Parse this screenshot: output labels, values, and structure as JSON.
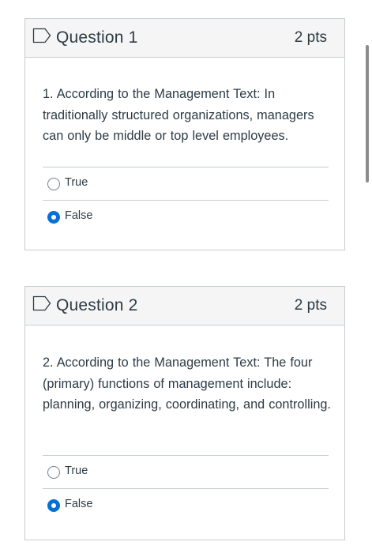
{
  "questions": [
    {
      "title": "Question 1",
      "points": "2 pts",
      "text": "1.  According to the Management Text:  In traditionally structured organizations, managers can only be middle or top level employees.",
      "answers": [
        {
          "label": "True",
          "selected": false
        },
        {
          "label": "False",
          "selected": true
        }
      ]
    },
    {
      "title": "Question 2",
      "points": "2 pts",
      "text": "2.  According to the Management Text:  The four (primary) functions of management include:  planning, organizing, coordinating, and controlling.",
      "answers": [
        {
          "label": "True",
          "selected": false
        },
        {
          "label": "False",
          "selected": true
        }
      ]
    }
  ],
  "icons": {
    "flag": "flag-outline-icon"
  },
  "colors": {
    "header_bg": "#f5f5f5",
    "border": "#c7cdd1",
    "text": "#2d3b45",
    "radio_selected": "#0770d5",
    "radio_unselected": "#73818c",
    "scrollbar": "#8c8c8c"
  }
}
